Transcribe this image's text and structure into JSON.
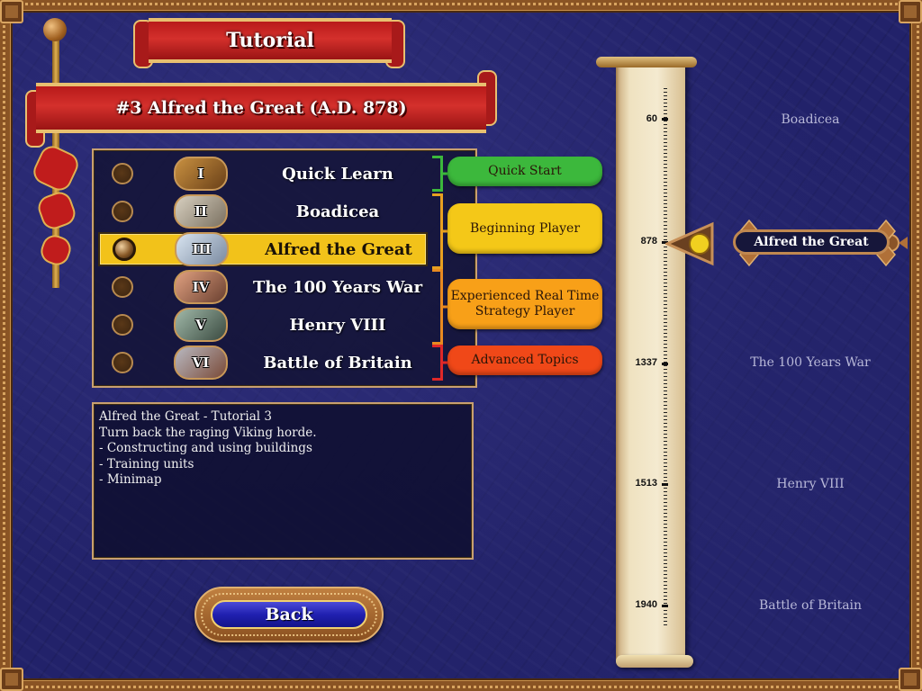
{
  "header": {
    "title": "Tutorial",
    "subtitle": "#3 Alfred the Great (A.D. 878)"
  },
  "tutorials": [
    {
      "numeral": "I",
      "label": "Quick Learn",
      "selected": false
    },
    {
      "numeral": "II",
      "label": "Boadicea",
      "selected": false
    },
    {
      "numeral": "III",
      "label": "Alfred the Great",
      "selected": true
    },
    {
      "numeral": "IV",
      "label": "The 100 Years War",
      "selected": false
    },
    {
      "numeral": "V",
      "label": "Henry VIII",
      "selected": false
    },
    {
      "numeral": "VI",
      "label": "Battle of Britain",
      "selected": false
    }
  ],
  "levels": [
    {
      "label": "Quick Start",
      "color": "#3cb83c",
      "bracket_color": "#3cb83c"
    },
    {
      "label": "Beginning Player",
      "color": "#f4c818",
      "bracket_color": "#e8a020"
    },
    {
      "label": "Experienced Real Time Strategy Player",
      "color": "#f8a018",
      "bracket_color": "#e88a20"
    },
    {
      "label": "Advanced Topics",
      "color": "#f04818",
      "bracket_color": "#e02828"
    }
  ],
  "description": {
    "lines": [
      "Alfred the Great - Tutorial 3",
      "Turn back the raging Viking horde.",
      "- Constructing and using buildings",
      "- Training units",
      "- Minimap"
    ]
  },
  "back_button": {
    "label": "Back"
  },
  "timeline": {
    "years": [
      "60",
      "878",
      "1337",
      "1513",
      "1940"
    ],
    "eras": [
      "Boadicea",
      "Alfred the Great",
      "The 100 Years War",
      "Henry VIII",
      "Battle of Britain"
    ],
    "current": "Alfred the Great"
  },
  "colors": {
    "selected_row": "#f2c21a",
    "banner_red": "#c41e1e",
    "background": "#22226a"
  }
}
